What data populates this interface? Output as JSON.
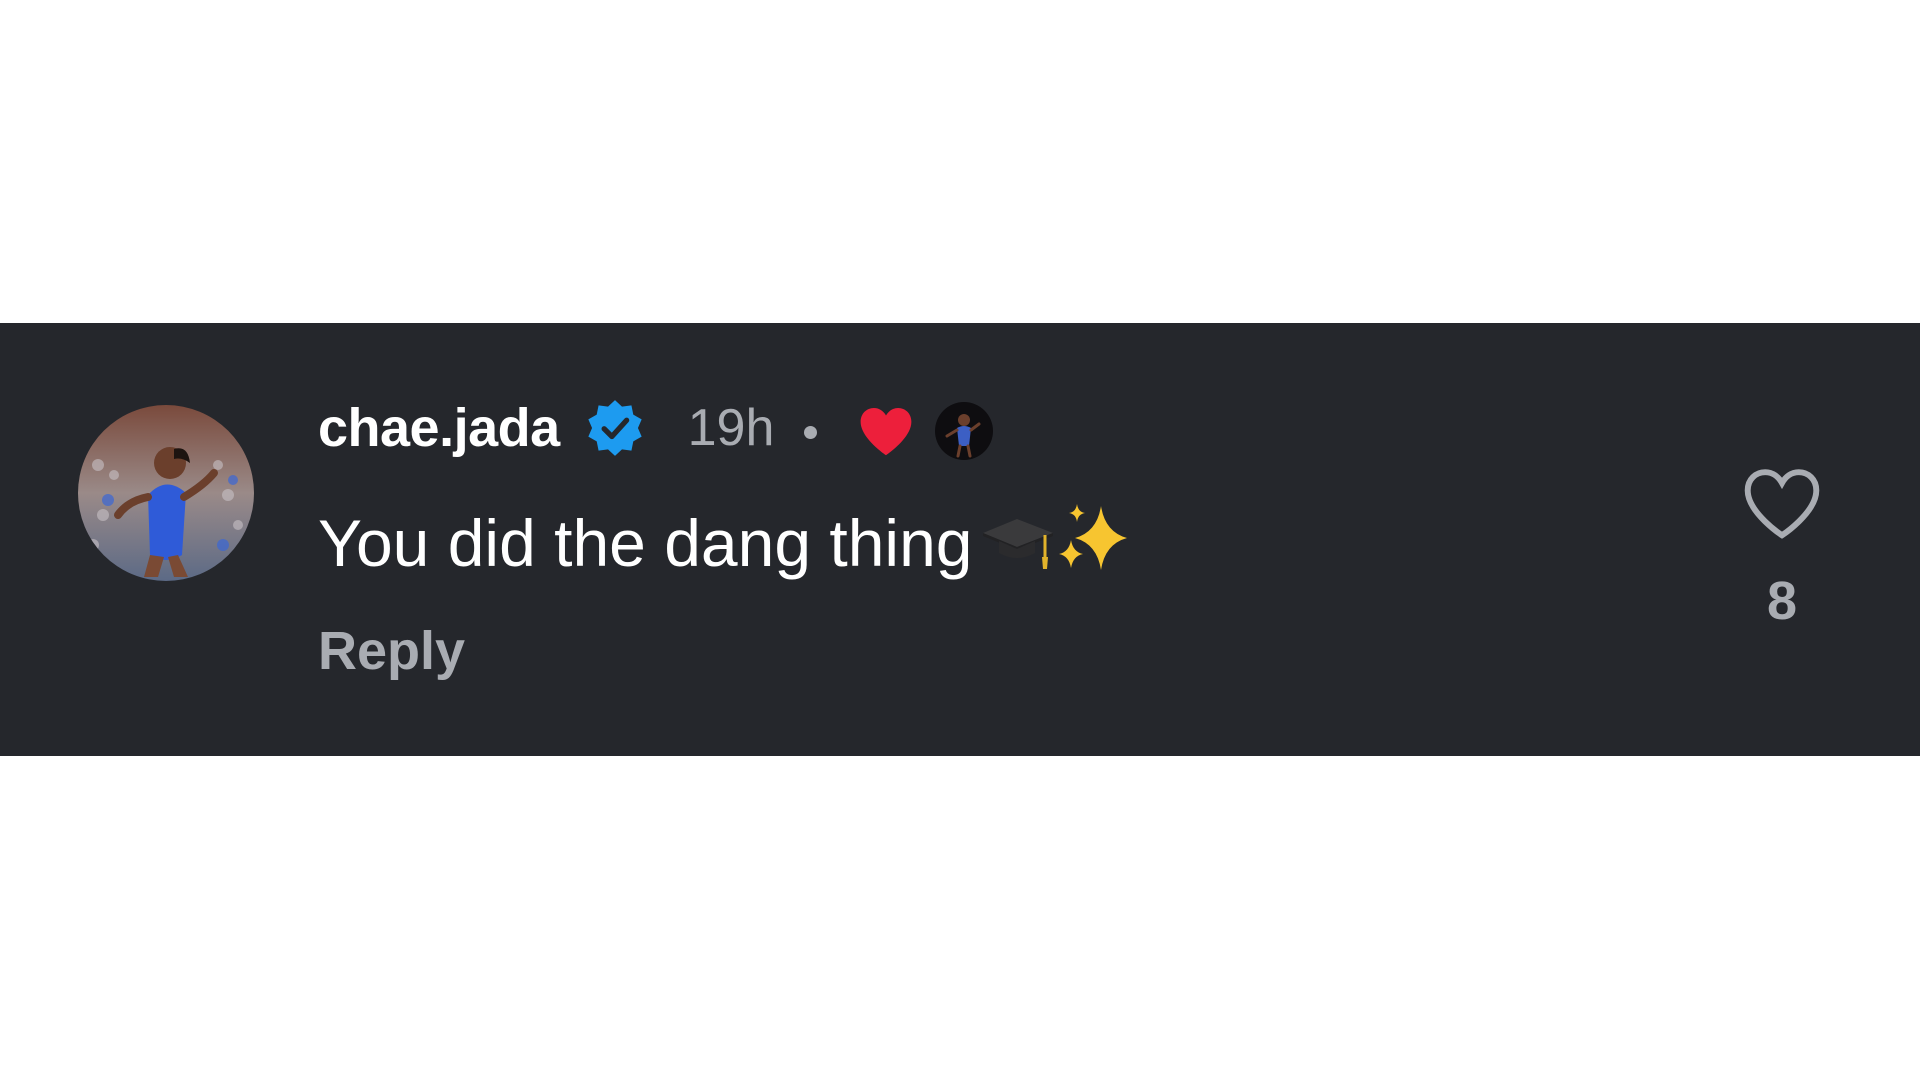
{
  "comment": {
    "username": "chae.jada",
    "verified_icon": "verified-badge-icon",
    "timestamp": "19h",
    "liked_by_creator_icon": "heart-filled-icon",
    "creator_avatar_icon": "creator-avatar",
    "text": "You did the dang thing",
    "emojis": [
      "graduation-cap-emoji",
      "sparkles-emoji"
    ],
    "reply_label": "Reply",
    "like_icon": "heart-outline-icon",
    "like_count": "8"
  },
  "colors": {
    "background": "#25272c",
    "primary_text": "#ffffff",
    "secondary_text": "#a9acb2",
    "verified_blue": "#1d9bf0",
    "heart_red": "#ed1f3b"
  }
}
